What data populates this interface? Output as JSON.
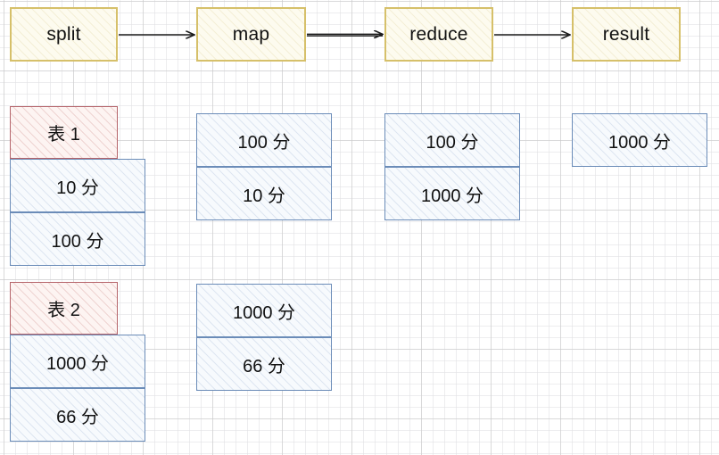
{
  "diagram": {
    "title": "MapReduce split map reduce result flow",
    "colors": {
      "stage_border": "#d6c06a",
      "stage_fill": "#fdfbef",
      "data_border": "#6b8cb8",
      "data_fill": "#f7fafd",
      "header_border": "#b5646a",
      "header_fill": "#fdf4f2",
      "arrow": "#1a1a1a",
      "grid_minor": "#e1e1e4",
      "grid_major": "#c8c8c8"
    },
    "pipeline": {
      "stages": [
        {
          "id": "split",
          "label": "split"
        },
        {
          "id": "map",
          "label": "map"
        },
        {
          "id": "reduce",
          "label": "reduce"
        },
        {
          "id": "result",
          "label": "result"
        }
      ],
      "arrows": [
        {
          "from": "split",
          "to": "map"
        },
        {
          "from": "map",
          "to": "reduce"
        },
        {
          "from": "reduce",
          "to": "result"
        }
      ]
    },
    "columns": [
      {
        "id": "split-column",
        "stage": "split",
        "groups": [
          {
            "id": "table-1",
            "header": "表 1",
            "rows": [
              "10 分",
              "100 分"
            ]
          },
          {
            "id": "table-2",
            "header": "表 2",
            "rows": [
              "1000 分",
              "66 分"
            ]
          }
        ]
      },
      {
        "id": "map-column",
        "stage": "map",
        "groups": [
          {
            "id": "map-output-1",
            "header": null,
            "rows": [
              "100 分",
              "10 分"
            ]
          },
          {
            "id": "map-output-2",
            "header": null,
            "rows": [
              "1000 分",
              "66 分"
            ]
          }
        ]
      },
      {
        "id": "reduce-column",
        "stage": "reduce",
        "groups": [
          {
            "id": "reduce-output-1",
            "header": null,
            "rows": [
              "100 分",
              "1000 分"
            ]
          }
        ]
      },
      {
        "id": "result-column",
        "stage": "result",
        "groups": [
          {
            "id": "result-output-1",
            "header": null,
            "rows": [
              "1000 分"
            ]
          }
        ]
      }
    ]
  }
}
